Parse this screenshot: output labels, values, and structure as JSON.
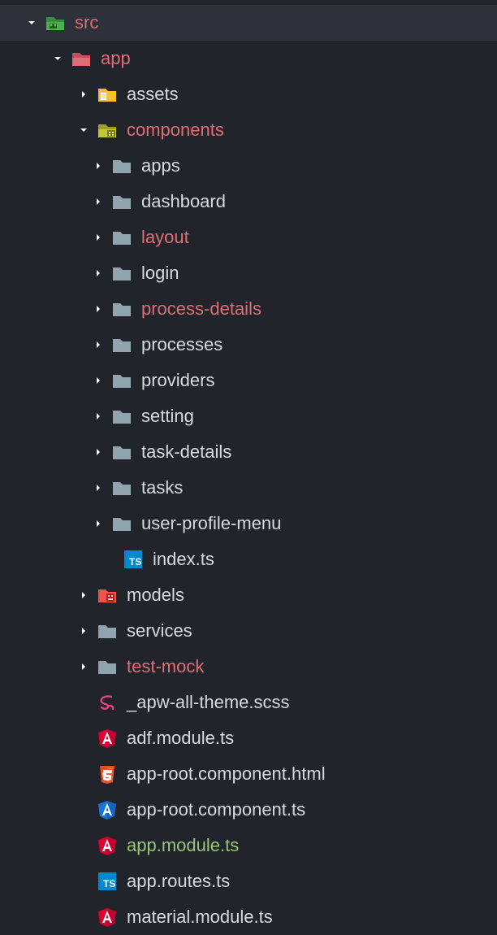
{
  "tree": {
    "src": {
      "label": "src",
      "app": {
        "label": "app",
        "assets": {
          "label": "assets"
        },
        "components": {
          "label": "components",
          "apps": {
            "label": "apps"
          },
          "dashboard": {
            "label": "dashboard"
          },
          "layout": {
            "label": "layout"
          },
          "login": {
            "label": "login"
          },
          "process_details": {
            "label": "process-details"
          },
          "processes": {
            "label": "processes"
          },
          "providers": {
            "label": "providers"
          },
          "setting": {
            "label": "setting"
          },
          "task_details": {
            "label": "task-details"
          },
          "tasks": {
            "label": "tasks"
          },
          "user_profile_menu": {
            "label": "user-profile-menu"
          },
          "index_ts": {
            "label": "index.ts"
          }
        },
        "models": {
          "label": "models"
        },
        "services": {
          "label": "services"
        },
        "test_mock": {
          "label": "test-mock"
        },
        "apw_all_theme": {
          "label": "_apw-all-theme.scss"
        },
        "adf_module": {
          "label": "adf.module.ts"
        },
        "app_root_component_html": {
          "label": "app-root.component.html"
        },
        "app_root_component_ts": {
          "label": "app-root.component.ts"
        },
        "app_module": {
          "label": "app.module.ts"
        },
        "app_routes": {
          "label": "app.routes.ts"
        },
        "material_module": {
          "label": "material.module.ts"
        }
      }
    }
  },
  "colors": {
    "modified": "#e06c75",
    "success": "#98c379",
    "default": "#d7dae0"
  }
}
